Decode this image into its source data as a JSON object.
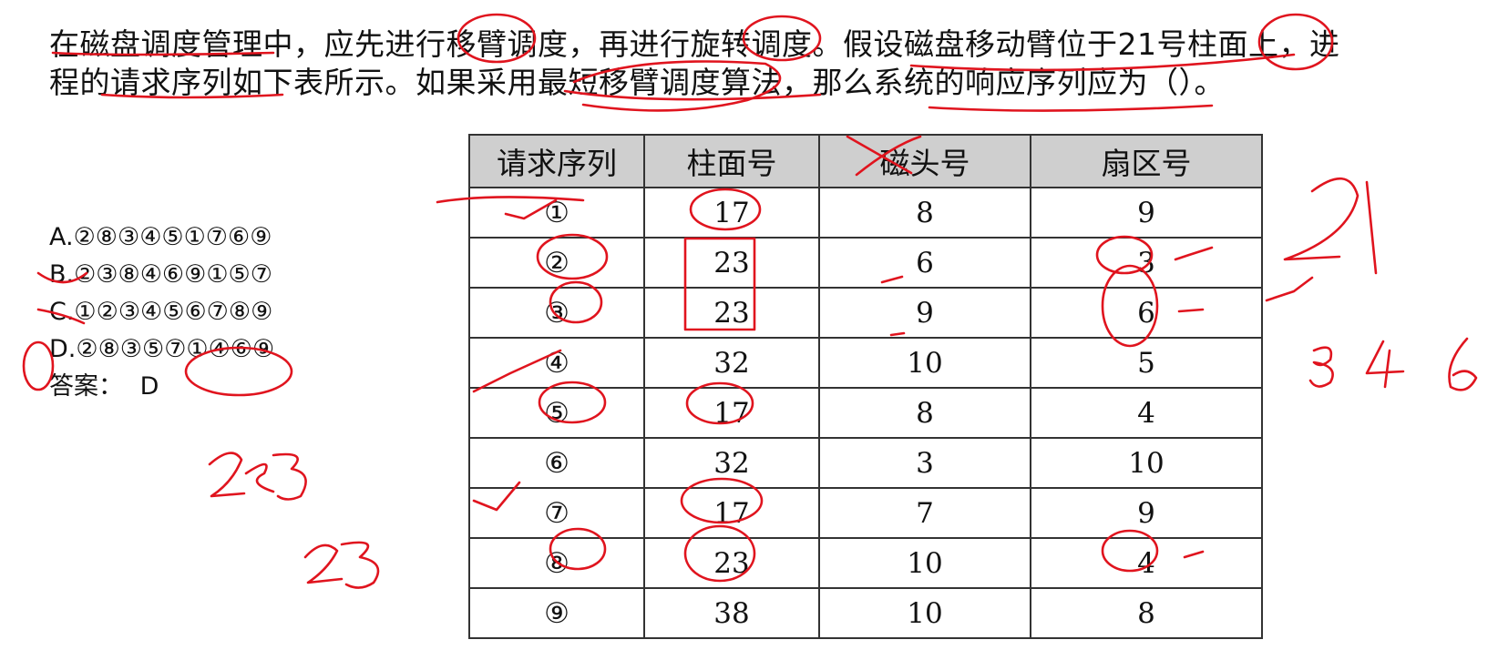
{
  "question": {
    "line1": "在磁盘调度管理中，应先进行移臂调度，再进行旋转调度。假设磁盘移动臂位于21号柱面上，进",
    "line2": "程的请求序列如下表所示。如果采用最短移臂调度算法，那么系统的响应序列应为（）。"
  },
  "table": {
    "headers": [
      "请求序列",
      "柱面号",
      "磁头号",
      "扇区号"
    ],
    "rows": [
      [
        "①",
        "17",
        "8",
        "9"
      ],
      [
        "②",
        "23",
        "6",
        "3"
      ],
      [
        "③",
        "23",
        "9",
        "6"
      ],
      [
        "④",
        "32",
        "10",
        "5"
      ],
      [
        "⑤",
        "17",
        "8",
        "4"
      ],
      [
        "⑥",
        "32",
        "3",
        "10"
      ],
      [
        "⑦",
        "17",
        "7",
        "9"
      ],
      [
        "⑧",
        "23",
        "10",
        "4"
      ],
      [
        "⑨",
        "38",
        "10",
        "8"
      ]
    ]
  },
  "options": {
    "a": "A.②⑧③④⑤①⑦⑥⑨",
    "b": "B.②③⑧④⑥⑨①⑤⑦",
    "c": "C.①②③④⑤⑥⑦⑧⑨",
    "d": "D.②⑧③⑤⑦①④⑥⑨",
    "answer_label": "答案：",
    "answer_value": "D"
  },
  "annotations": {
    "ink_color": "#e0141e",
    "handwriting_note": "21 3 4 6 283 23"
  }
}
